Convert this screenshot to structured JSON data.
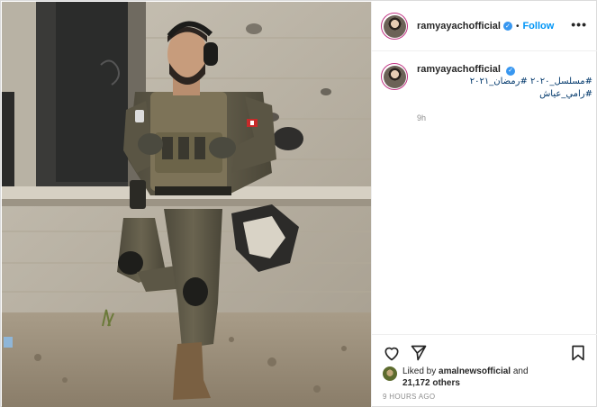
{
  "post": {
    "username": "ramyayachofficial",
    "verified_mark": "✓",
    "follow_label": "Follow",
    "separator": "•",
    "more_label": "•••"
  },
  "caption": {
    "username": "ramyayachofficial",
    "text": "#مسلسل_٢٠٢٠ #رمضان_٢٠٢١ #رامي_عياش",
    "time": "9h"
  },
  "actions": {
    "like_icon": "heart-icon",
    "share_icon": "paper-plane-icon",
    "save_icon": "bookmark-icon"
  },
  "likes": {
    "prefix": "Liked by ",
    "user": "amalnewsofficial",
    "middle": " and",
    "others": "21,172 others"
  },
  "timestamp": "9 HOURS AGO",
  "colors": {
    "accent": "#0095f6",
    "verified": "#3897f0",
    "muted": "#8e8e8e"
  }
}
